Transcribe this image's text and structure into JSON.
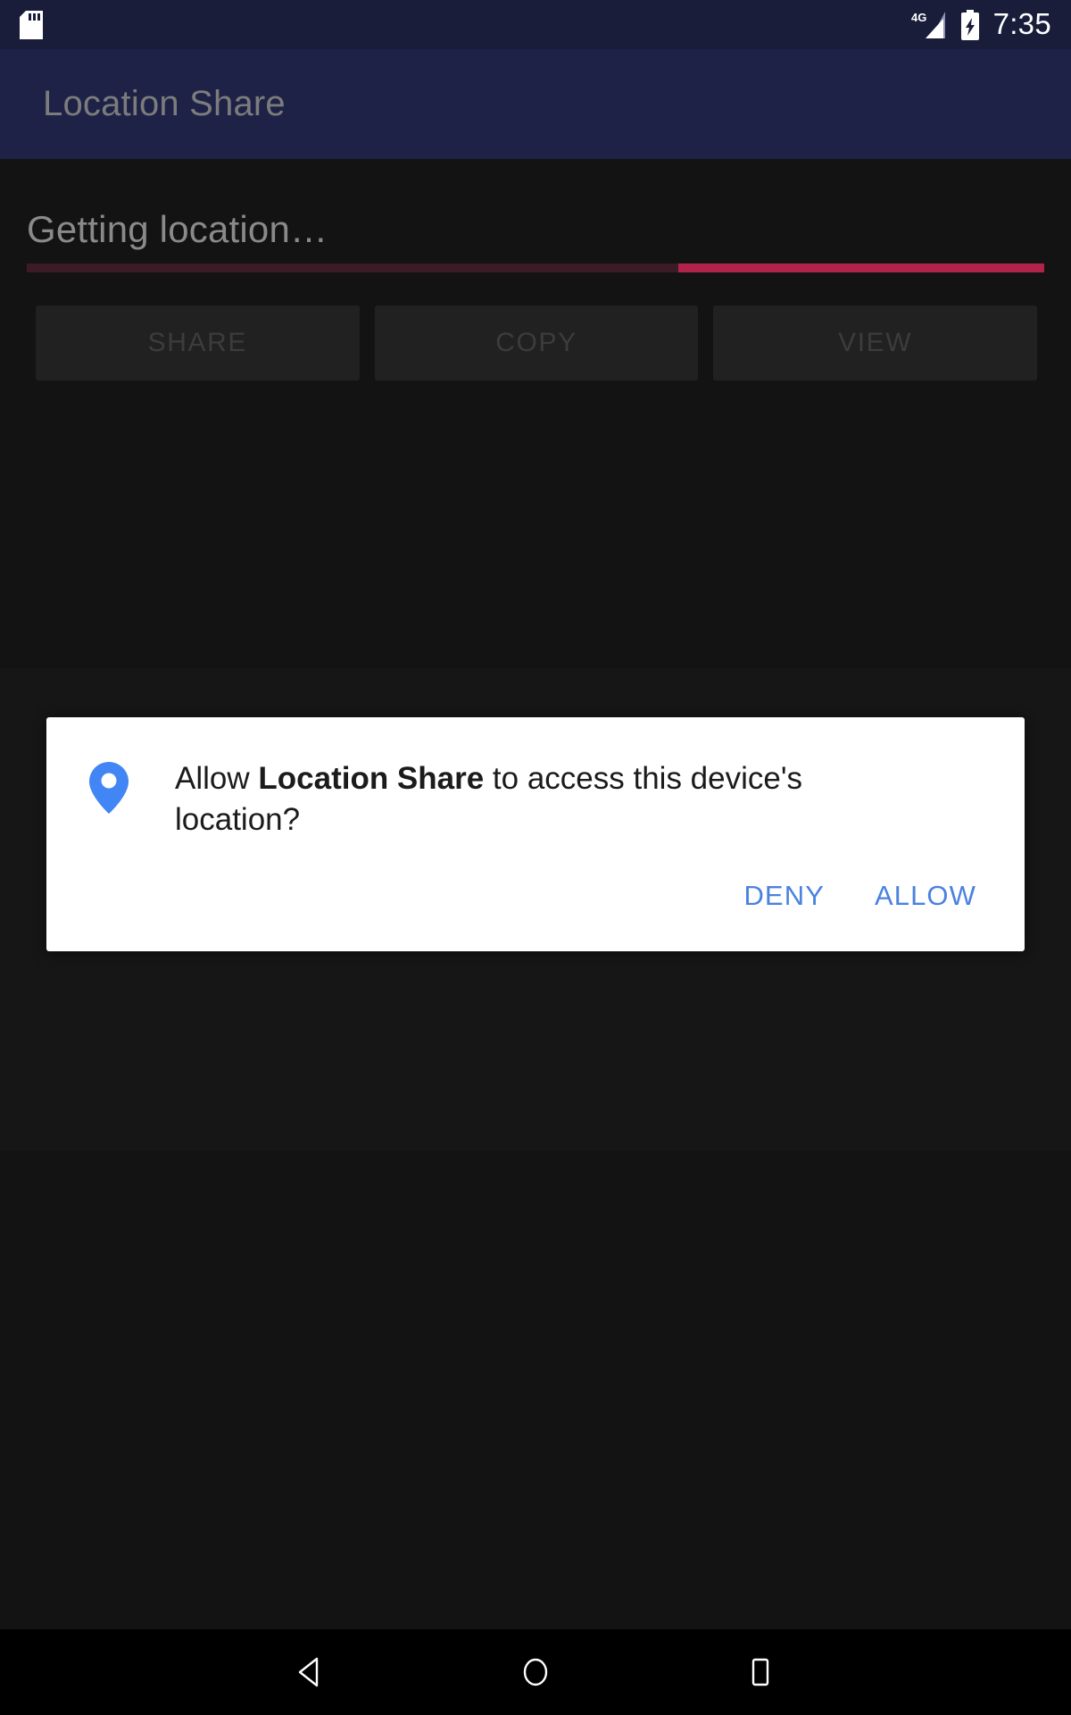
{
  "status_bar": {
    "sd_card_icon": "sd-card-icon",
    "network_label": "4G",
    "signal_icon": "signal-bars-icon",
    "battery_icon": "battery-charging-icon",
    "time": "7:35"
  },
  "app_bar": {
    "title": "Location Share"
  },
  "main": {
    "status_text": "Getting location…",
    "progress": {
      "indeterminate": true,
      "track_color": "#3a1b26",
      "fill_color": "#b2234c",
      "fill_percent": 36,
      "fill_offset_percent": 64
    },
    "buttons": [
      {
        "label": "SHARE",
        "name": "share-button",
        "enabled": false
      },
      {
        "label": "COPY",
        "name": "copy-button",
        "enabled": false
      },
      {
        "label": "VIEW",
        "name": "view-button",
        "enabled": false
      }
    ]
  },
  "dialog": {
    "icon": "location-pin-icon",
    "icon_color": "#4285f4",
    "message_prefix": "Allow ",
    "message_app": "Location Share",
    "message_suffix": " to access this device's location?",
    "deny_label": "DENY",
    "allow_label": "ALLOW",
    "action_color": "#4a82e0",
    "background": "#ffffff"
  },
  "nav_bar": {
    "back_icon": "back-triangle-icon",
    "home_icon": "home-circle-icon",
    "recents_icon": "recents-square-icon"
  },
  "theme": {
    "status_bar_bg": "#191d3a",
    "app_bar_bg": "#1e2247",
    "content_bg": "#131313",
    "button_bg": "#212121",
    "disabled_text": "#3c3c3c"
  }
}
